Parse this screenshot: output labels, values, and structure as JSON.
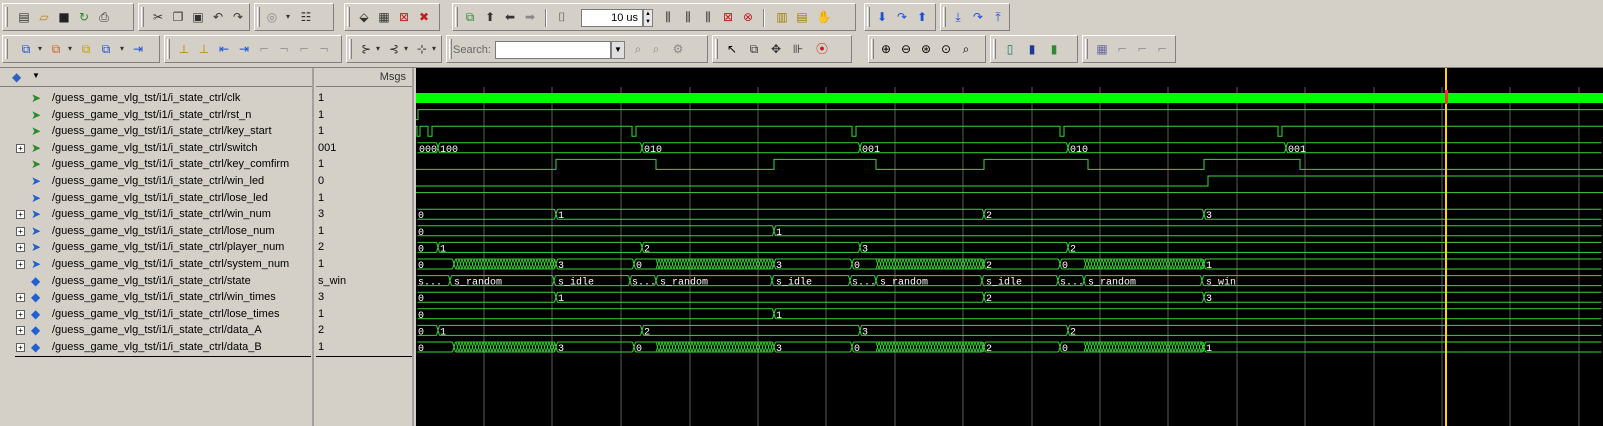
{
  "toolbar": {
    "row1": {
      "file_icons": [
        "new-file-icon",
        "open-folder-icon",
        "save-icon",
        "reload-icon",
        "print-icon"
      ],
      "edit_icons": [
        "cut-icon",
        "copy-icon",
        "paste-icon",
        "undo-icon",
        "redo-icon"
      ],
      "find_icons": [
        "find-icon",
        "list-icon"
      ],
      "compile_icons": [
        "compile-icon",
        "compile-all-icon",
        "simulate-icon",
        "break-icon"
      ],
      "run_icons": [
        "restart-icon",
        "up-arrow-icon",
        "back-arrow-icon",
        "forward-arrow-icon"
      ],
      "run_length": "10 us",
      "run_icons_2": [
        "run-icon",
        "run-continue-icon",
        "run-all-icon",
        "stop-icon",
        "break-point-icon"
      ],
      "misc_icons": [
        "dataflow-icon",
        "schematic-icon",
        "hand-icon"
      ],
      "step_icons": [
        "step-icon",
        "step-over-icon",
        "step-out-icon"
      ],
      "step_icons_2": [
        "step-into-icon",
        "step-over-2-icon",
        "step-up-icon"
      ]
    },
    "row2": {
      "wave_icons": [
        "add-wave-icon",
        "add-wave-2-icon",
        "add-wave-3-icon",
        "add-wave-4-icon",
        "insert-divider-icon"
      ],
      "cursor_icons": [
        "add-cursor-icon",
        "delete-cursor-icon",
        "cursor-left-icon",
        "cursor-right-icon",
        "edge-prev-icon",
        "edge-next-icon",
        "edge-any-icon"
      ],
      "expand_icons": [
        "expand-left-icon",
        "expand-right-icon",
        "expand-center-icon"
      ],
      "search_label": "Search:",
      "search_value": "",
      "search_icons": [
        "search-prev-icon",
        "search-next-icon"
      ],
      "mode_icons": [
        "select-mode-icon",
        "zoom-mode-icon",
        "pan-mode-icon",
        "measure-mode-icon",
        "dataflow-mode-icon"
      ],
      "zoom_icons": [
        "zoom-in-icon",
        "zoom-out-icon",
        "zoom-full-icon",
        "zoom-cursor-icon",
        "zoom-range-icon"
      ],
      "format_icons": [
        "format-1-icon",
        "format-2-icon",
        "format-3-icon",
        "format-4-icon",
        "format-5-icon",
        "format-6-icon"
      ]
    }
  },
  "header": {
    "msgs": "Msgs"
  },
  "signals": [
    {
      "name": "/guess_game_vlg_tst/i1/i_state_ctrl/clk",
      "value": "1",
      "expandable": false,
      "kind": "in"
    },
    {
      "name": "/guess_game_vlg_tst/i1/i_state_ctrl/rst_n",
      "value": "1",
      "expandable": false,
      "kind": "in"
    },
    {
      "name": "/guess_game_vlg_tst/i1/i_state_ctrl/key_start",
      "value": "1",
      "expandable": false,
      "kind": "in"
    },
    {
      "name": "/guess_game_vlg_tst/i1/i_state_ctrl/switch",
      "value": "001",
      "expandable": true,
      "kind": "in"
    },
    {
      "name": "/guess_game_vlg_tst/i1/i_state_ctrl/key_comfirm",
      "value": "1",
      "expandable": false,
      "kind": "in"
    },
    {
      "name": "/guess_game_vlg_tst/i1/i_state_ctrl/win_led",
      "value": "0",
      "expandable": false,
      "kind": "out"
    },
    {
      "name": "/guess_game_vlg_tst/i1/i_state_ctrl/lose_led",
      "value": "1",
      "expandable": false,
      "kind": "out"
    },
    {
      "name": "/guess_game_vlg_tst/i1/i_state_ctrl/win_num",
      "value": "3",
      "expandable": true,
      "kind": "out"
    },
    {
      "name": "/guess_game_vlg_tst/i1/i_state_ctrl/lose_num",
      "value": "1",
      "expandable": true,
      "kind": "out"
    },
    {
      "name": "/guess_game_vlg_tst/i1/i_state_ctrl/player_num",
      "value": "2",
      "expandable": true,
      "kind": "out"
    },
    {
      "name": "/guess_game_vlg_tst/i1/i_state_ctrl/system_num",
      "value": "1",
      "expandable": true,
      "kind": "out"
    },
    {
      "name": "/guess_game_vlg_tst/i1/i_state_ctrl/state",
      "value": "s_win",
      "expandable": false,
      "kind": "internal"
    },
    {
      "name": "/guess_game_vlg_tst/i1/i_state_ctrl/win_times",
      "value": "3",
      "expandable": true,
      "kind": "internal"
    },
    {
      "name": "/guess_game_vlg_tst/i1/i_state_ctrl/lose_times",
      "value": "1",
      "expandable": true,
      "kind": "internal"
    },
    {
      "name": "/guess_game_vlg_tst/i1/i_state_ctrl/data_A",
      "value": "2",
      "expandable": true,
      "kind": "internal"
    },
    {
      "name": "/guess_game_vlg_tst/i1/i_state_ctrl/data_B",
      "value": "1",
      "expandable": true,
      "kind": "internal"
    }
  ],
  "waves": {
    "bus_labels": [
      [
        "000",
        "100",
        "010",
        "001",
        "010",
        "001"
      ],
      [
        "0",
        "1",
        "2",
        "3"
      ],
      [
        "0",
        "1"
      ],
      [
        "0",
        "1",
        "2",
        "3",
        "2"
      ],
      [
        "0",
        "3",
        "0",
        "3",
        "0",
        "2",
        "0",
        "1"
      ],
      [
        "s...",
        "s_random",
        "s_idle",
        "s...",
        "s_random",
        "s_idle",
        "s...",
        "s_random",
        "s_idle",
        "s...",
        "s_random",
        "s_win"
      ],
      [
        "0",
        "1",
        "2",
        "3"
      ],
      [
        "0",
        "1"
      ],
      [
        "0",
        "1",
        "2",
        "3",
        "2"
      ],
      [
        "0",
        "3",
        "0",
        "3",
        "0",
        "2",
        "0",
        "1"
      ]
    ]
  },
  "colors": {
    "wave": "#39d839",
    "clk": "#00ff00",
    "cursor": "#ffd400",
    "grid": "#5a5a5a",
    "background": "#000000"
  }
}
